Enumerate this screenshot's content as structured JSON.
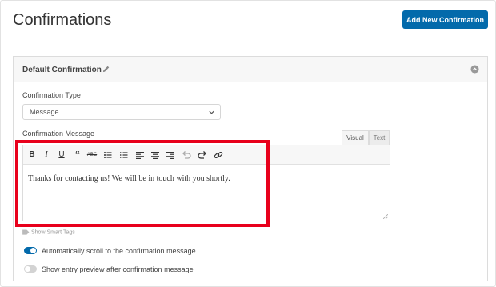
{
  "header": {
    "title": "Confirmations",
    "add_button_label": "Add New Confirmation"
  },
  "panel": {
    "title": "Default Confirmation"
  },
  "form": {
    "type_label": "Confirmation Type",
    "type_value": "Message",
    "message_label": "Confirmation Message",
    "tabs": [
      {
        "label": "Visual",
        "active": true
      },
      {
        "label": "Text",
        "active": false
      }
    ],
    "toolbar": [
      "bold",
      "italic",
      "underline",
      "blockquote",
      "strikethrough",
      "bullet-list",
      "numbered-list",
      "align-left",
      "align-center",
      "align-right",
      "undo",
      "redo",
      "link"
    ],
    "message_value": "Thanks for contacting us! We will be in touch with you shortly.",
    "smart_tags_label": "Show Smart Tags",
    "toggles": [
      {
        "label": "Automatically scroll to the confirmation message",
        "on": true
      },
      {
        "label": "Show entry preview after confirmation message",
        "on": false
      }
    ]
  },
  "colors": {
    "accent": "#036aab",
    "highlight": "#e8001c"
  }
}
